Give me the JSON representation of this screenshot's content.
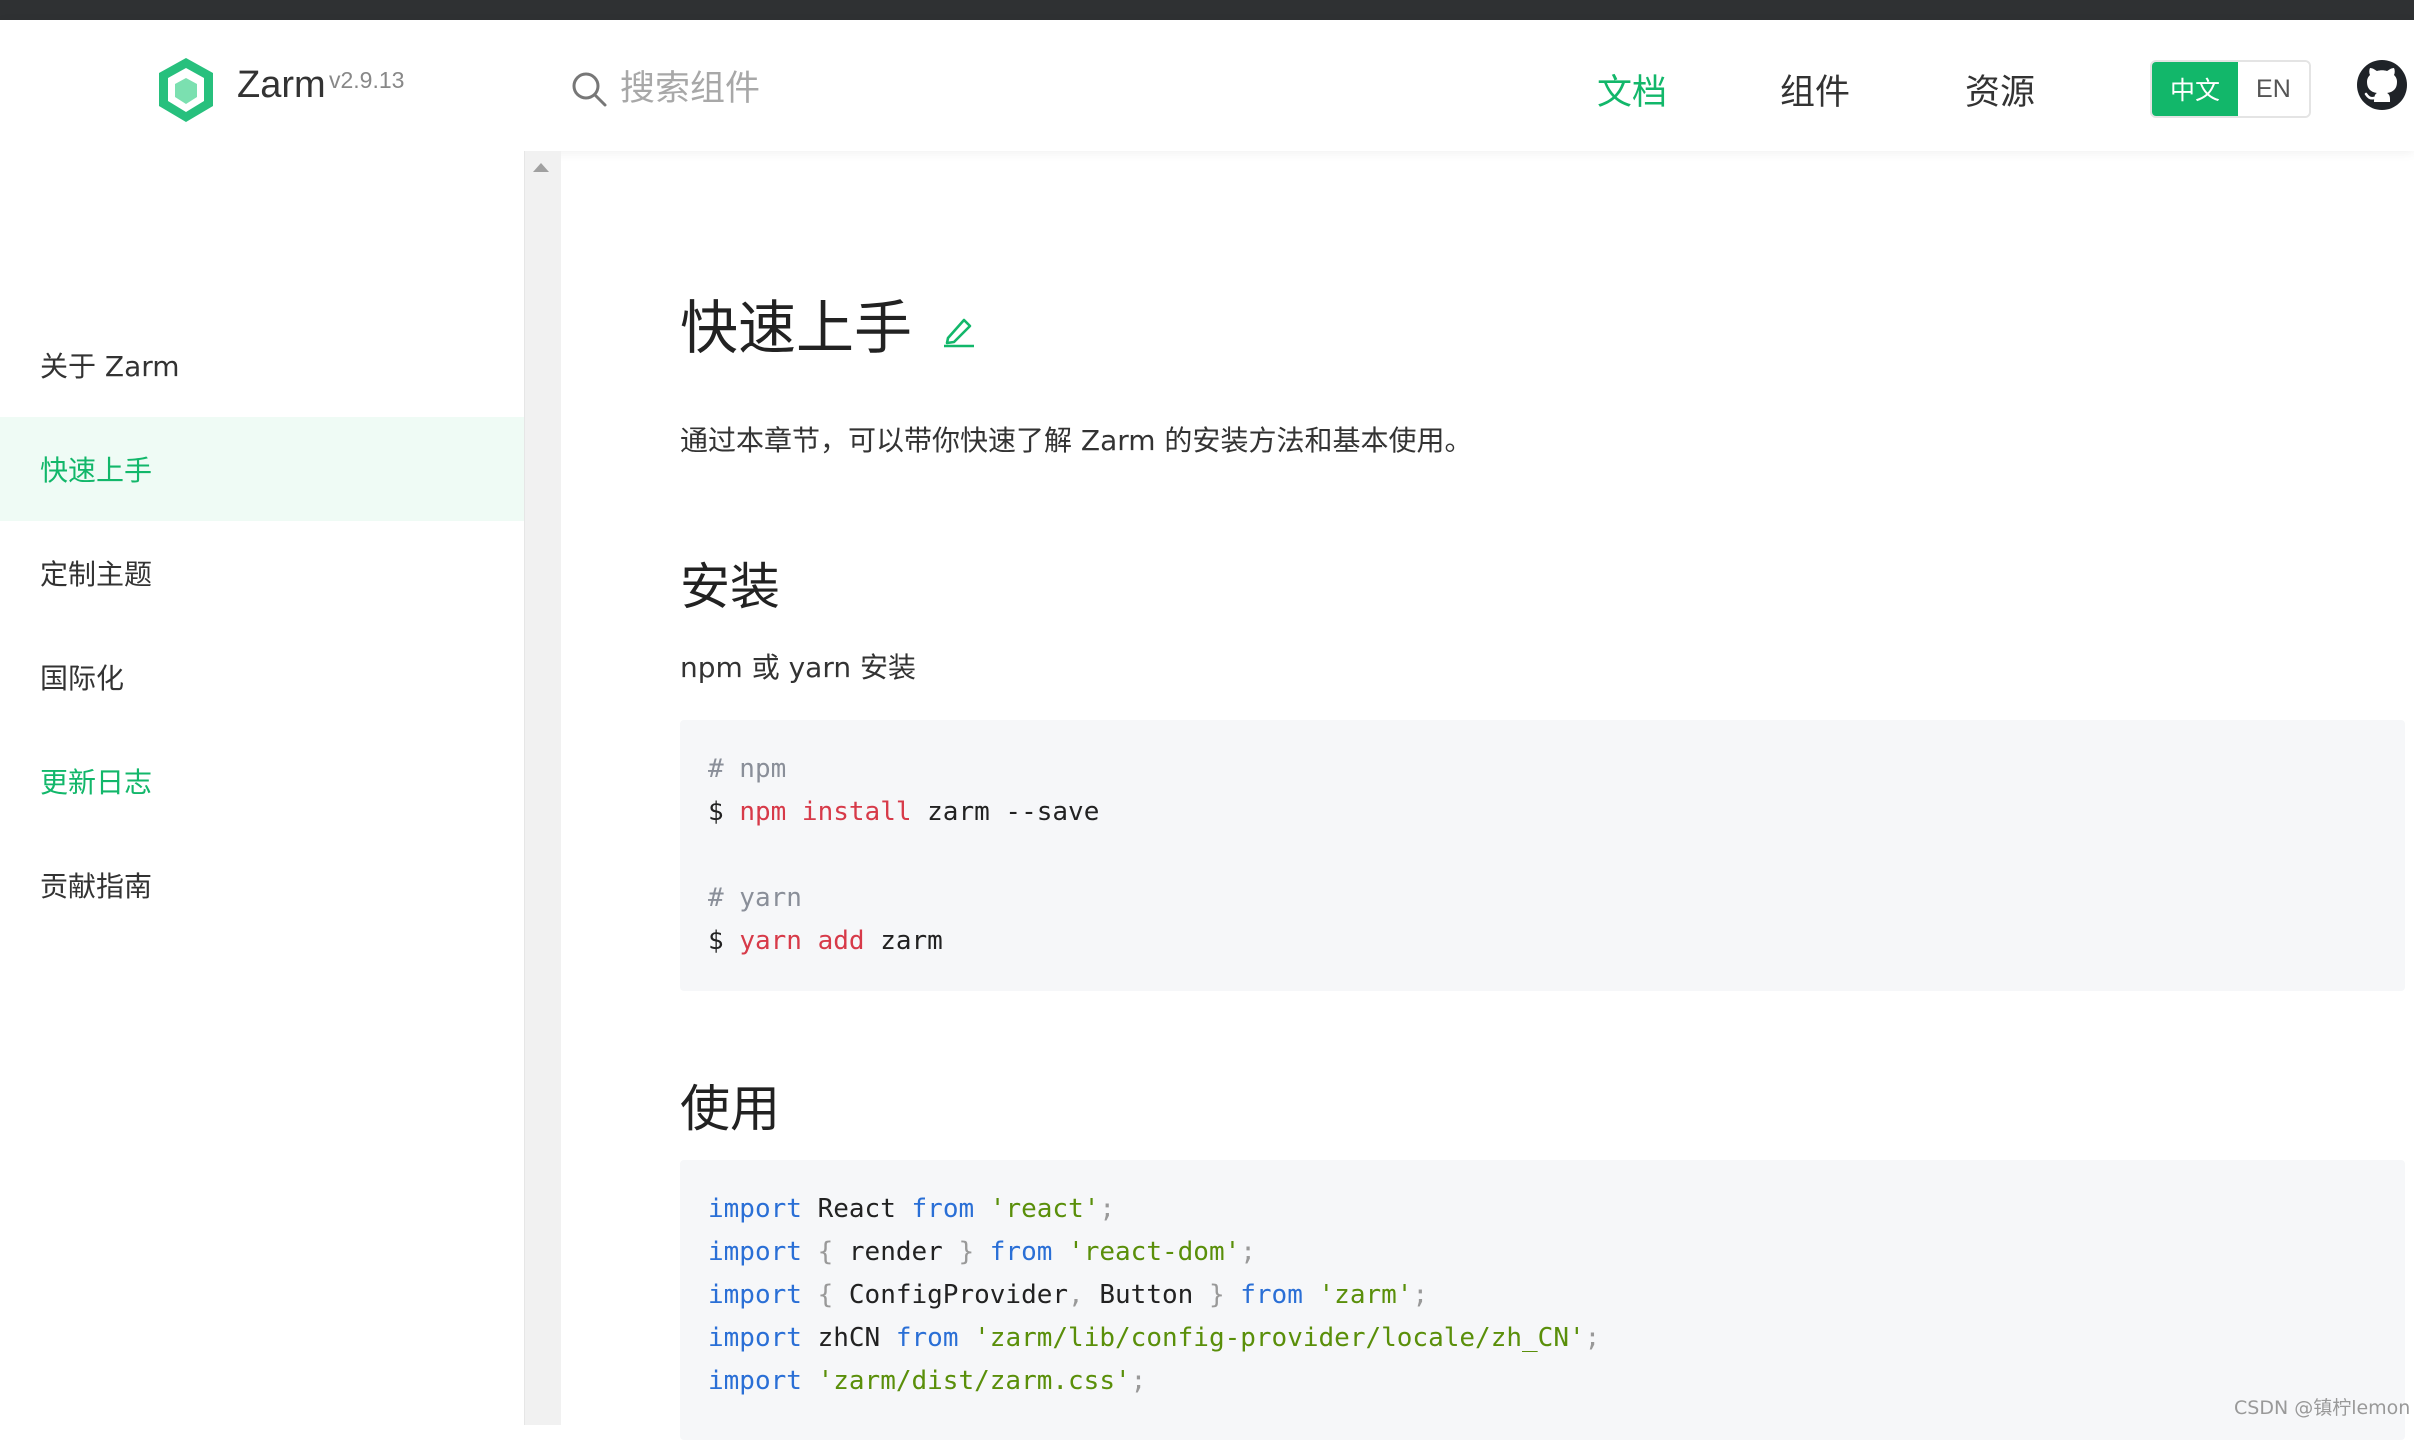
{
  "header": {
    "brand": "Zarm",
    "version": "v2.9.13",
    "search_placeholder": "搜索组件",
    "nav": [
      {
        "label": "文档"
      },
      {
        "label": "组件"
      },
      {
        "label": "资源"
      }
    ],
    "lang": {
      "zh": "中文",
      "en": "EN"
    },
    "colors": {
      "accent": "#12b76a"
    }
  },
  "sidebar": {
    "items": [
      {
        "label": "关于 Zarm"
      },
      {
        "label": "快速上手"
      },
      {
        "label": "定制主题"
      },
      {
        "label": "国际化"
      },
      {
        "label": "更新日志"
      },
      {
        "label": "贡献指南"
      }
    ]
  },
  "main": {
    "title": "快速上手",
    "intro": "通过本章节，可以带你快速了解 Zarm 的安装方法和基本使用。",
    "install": {
      "heading": "安装",
      "desc": "npm 或 yarn 安装",
      "code": {
        "comment_npm": "# npm",
        "prompt": "$",
        "npm_cmd": "npm install",
        "npm_args": "zarm --save",
        "comment_yarn": "# yarn",
        "yarn_cmd": "yarn add",
        "yarn_args": "zarm"
      }
    },
    "usage": {
      "heading": "使用",
      "code": {
        "kw_import": "import",
        "kw_from": "from",
        "l1_name": "React",
        "l1_src": "'react'",
        "l2_name": "render",
        "l2_src": "'react-dom'",
        "l3_name1": "ConfigProvider",
        "l3_name2": "Button",
        "l3_src": "'zarm'",
        "l4_name": "zhCN",
        "l4_src": "'zarm/lib/config-provider/locale/zh_CN'",
        "l5_src": "'zarm/dist/zarm.css'",
        "semi": ";",
        "lbrace": "{",
        "rbrace": "}",
        "comma": ","
      }
    }
  },
  "watermark": "CSDN @镇柠lemon"
}
